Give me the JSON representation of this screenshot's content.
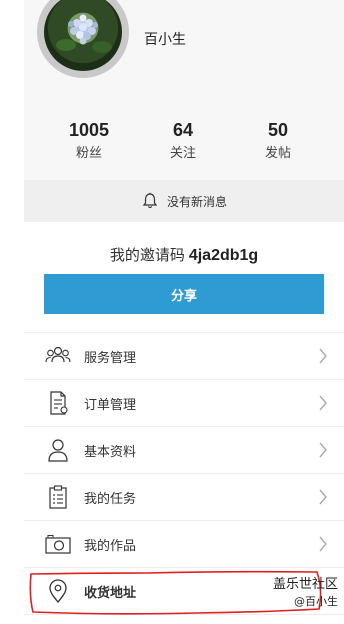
{
  "profile": {
    "username": "百小生",
    "stats": [
      {
        "value": "1005",
        "label": "粉丝"
      },
      {
        "value": "64",
        "label": "关注"
      },
      {
        "value": "50",
        "label": "发帖"
      }
    ]
  },
  "notice": {
    "text": "没有新消息",
    "icon": "bell-icon"
  },
  "invite": {
    "label": "我的邀请码",
    "code": "4ja2db1g"
  },
  "share_button": {
    "label": "分享"
  },
  "menu": [
    {
      "label": "服务管理",
      "icon": "people-icon"
    },
    {
      "label": "订单管理",
      "icon": "order-document-icon"
    },
    {
      "label": "基本资料",
      "icon": "user-icon"
    },
    {
      "label": "我的任务",
      "icon": "clipboard-icon"
    },
    {
      "label": "我的作品",
      "icon": "camera-icon"
    },
    {
      "label": "收货地址",
      "icon": "location-pin-icon"
    }
  ],
  "watermark": {
    "line1": "盖乐世社区",
    "line2": "@百小生"
  },
  "colors": {
    "accent": "#2f9bd3",
    "annotation": "#e02020"
  }
}
